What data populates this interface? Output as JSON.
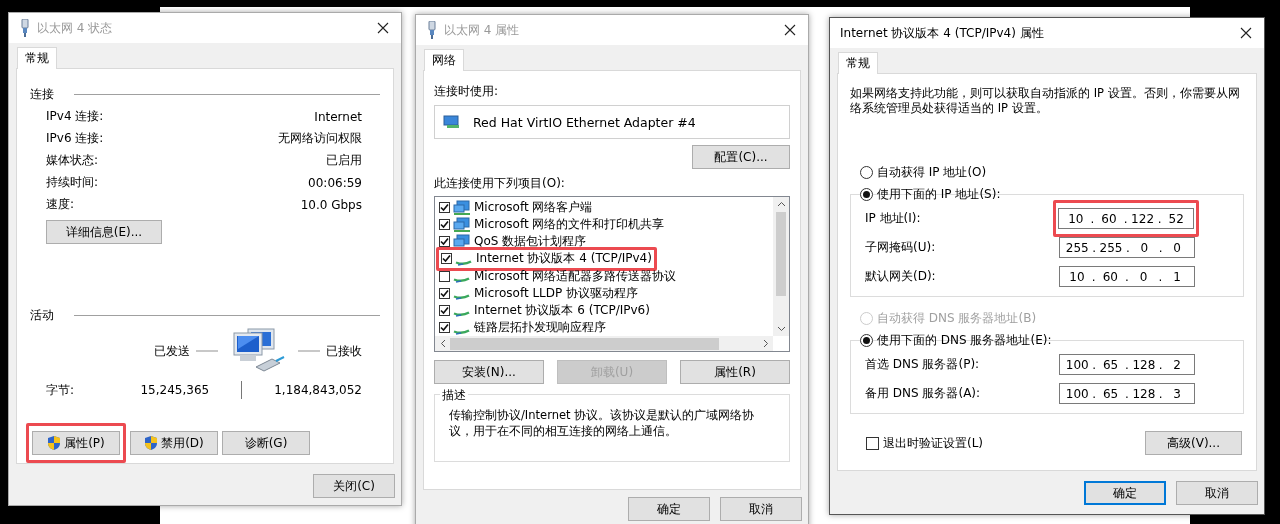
{
  "status_dialog": {
    "title": "以太网 4 状态",
    "tabs": [
      {
        "label": "常规",
        "selected": true
      }
    ],
    "connection": {
      "heading": "连接",
      "rows": [
        {
          "label": "IPv4 连接:",
          "value": "Internet"
        },
        {
          "label": "IPv6 连接:",
          "value": "无网络访问权限"
        },
        {
          "label": "媒体状态:",
          "value": "已启用"
        },
        {
          "label": "持续时间:",
          "value": "00:06:59"
        },
        {
          "label": "速度:",
          "value": "10.0 Gbps"
        }
      ]
    },
    "details_button": "详细信息(E)...",
    "activity": {
      "heading": "活动",
      "sent_label": "已发送",
      "received_label": "已接收",
      "bytes_label": "字节:",
      "sent": "15,245,365",
      "received": "1,184,843,052"
    },
    "buttons": [
      {
        "label": "属性(P)",
        "shield": true,
        "highlighted": true
      },
      {
        "label": "禁用(D)",
        "shield": true,
        "highlighted": false
      },
      {
        "label": "诊断(G)",
        "shield": false,
        "highlighted": false
      }
    ],
    "close_button": "关闭(C)"
  },
  "properties_dialog": {
    "title": "以太网 4 属性",
    "tabs": [
      {
        "label": "网络",
        "selected": true
      }
    ],
    "connect_using_label": "连接时使用:",
    "adapter": "Red Hat VirtIO Ethernet Adapter #4",
    "configure_button": "配置(C)...",
    "items_label": "此连接使用下列项目(O):",
    "items": [
      {
        "label": "Microsoft 网络客户端",
        "kind": "service",
        "checked": true,
        "highlighted": false
      },
      {
        "label": "Microsoft 网络的文件和打印机共享",
        "kind": "service",
        "checked": true,
        "highlighted": false
      },
      {
        "label": "QoS 数据包计划程序",
        "kind": "service",
        "checked": true,
        "highlighted": false
      },
      {
        "label": "Internet 协议版本 4 (TCP/IPv4)",
        "kind": "protocol",
        "checked": true,
        "highlighted": true
      },
      {
        "label": "Microsoft 网络适配器多路传送器协议",
        "kind": "protocol",
        "checked": false,
        "highlighted": false
      },
      {
        "label": "Microsoft LLDP 协议驱动程序",
        "kind": "protocol",
        "checked": true,
        "highlighted": false
      },
      {
        "label": "Internet 协议版本 6 (TCP/IPv6)",
        "kind": "protocol",
        "checked": true,
        "highlighted": false
      },
      {
        "label": "链路层拓扑发现响应程序",
        "kind": "protocol",
        "checked": true,
        "highlighted": false
      }
    ],
    "buttons": [
      {
        "label": "安装(N)...",
        "disabled": false
      },
      {
        "label": "卸载(U)",
        "disabled": true
      },
      {
        "label": "属性(R)",
        "disabled": false
      }
    ],
    "description": {
      "heading": "描述",
      "text": "传输控制协议/Internet 协议。该协议是默认的广域网络协议，用于在不同的相互连接的网络上通信。"
    },
    "footer_buttons": [
      {
        "label": "确定",
        "default": false
      },
      {
        "label": "取消",
        "default": false
      }
    ]
  },
  "ipv4_dialog": {
    "title": "Internet 协议版本 4 (TCP/IPv4) 属性",
    "tabs": [
      {
        "label": "常规",
        "selected": true
      }
    ],
    "intro": "如果网络支持此功能，则可以获取自动指派的 IP 设置。否则，你需要从网络系统管理员处获得适当的 IP 设置。",
    "ip_options": [
      {
        "label": "自动获得 IP 地址(O)",
        "selected": false,
        "disabled": false
      },
      {
        "label": "使用下面的 IP 地址(S):",
        "selected": true,
        "disabled": false
      }
    ],
    "ip_fields": [
      {
        "label": "IP 地址(I):",
        "octets": [
          "10",
          "60",
          "122",
          "52"
        ],
        "highlighted": true
      },
      {
        "label": "子网掩码(U):",
        "octets": [
          "255",
          "255",
          "0",
          "0"
        ],
        "highlighted": false
      },
      {
        "label": "默认网关(D):",
        "octets": [
          "10",
          "60",
          "0",
          "1"
        ],
        "highlighted": false
      }
    ],
    "dns_options": [
      {
        "label": "自动获得 DNS 服务器地址(B)",
        "selected": false,
        "disabled": true
      },
      {
        "label": "使用下面的 DNS 服务器地址(E):",
        "selected": true,
        "disabled": false
      }
    ],
    "dns_fields": [
      {
        "label": "首选 DNS 服务器(P):",
        "octets": [
          "100",
          "65",
          "128",
          "2"
        ],
        "highlighted": false
      },
      {
        "label": "备用 DNS 服务器(A):",
        "octets": [
          "100",
          "65",
          "128",
          "3"
        ],
        "highlighted": false
      }
    ],
    "separator": ".",
    "validate_checkbox": {
      "label": "退出时验证设置(L)",
      "checked": false
    },
    "advanced_button": "高级(V)...",
    "footer_buttons": [
      {
        "label": "确定",
        "default": true
      },
      {
        "label": "取消",
        "default": false
      }
    ]
  }
}
